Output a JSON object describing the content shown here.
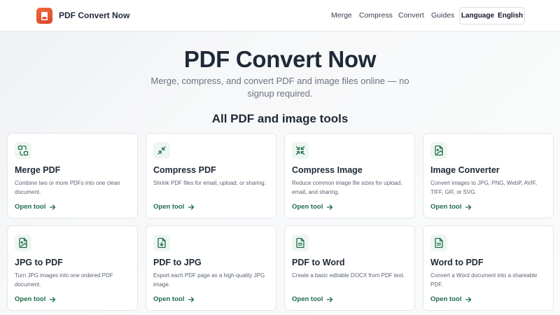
{
  "header": {
    "brand": "PDF Convert Now",
    "nav": [
      "Merge",
      "Compress",
      "Convert",
      "Guides"
    ],
    "language_label": "Language",
    "language_value": "English"
  },
  "hero": {
    "title": "PDF Convert Now",
    "subtitle": "Merge, compress, and convert PDF and image files online — no signup required."
  },
  "section": {
    "title": "All PDF and image tools"
  },
  "tools": [
    {
      "title": "Merge PDF",
      "desc": "Combine two or more PDFs into one clean document.",
      "link": "Open tool",
      "icon": "merge-icon"
    },
    {
      "title": "Compress PDF",
      "desc": "Shrink PDF files for email, upload, or sharing.",
      "link": "Open tool",
      "icon": "compress-icon"
    },
    {
      "title": "Compress Image",
      "desc": "Reduce common image file sizes for upload, email, and sharing.",
      "link": "Open tool",
      "icon": "compress-icon"
    },
    {
      "title": "Image Converter",
      "desc": "Convert images to JPG, PNG, WebP, AVIF, TIFF, GIF, or SVG.",
      "link": "Open tool",
      "icon": "image-file-icon"
    },
    {
      "title": "JPG to PDF",
      "desc": "Turn JPG images into one ordered PDF document.",
      "link": "Open tool",
      "icon": "image-file-icon"
    },
    {
      "title": "PDF to JPG",
      "desc": "Export each PDF page as a high-quality JPG image.",
      "link": "Open tool",
      "icon": "file-export-icon"
    },
    {
      "title": "PDF to Word",
      "desc": "Create a basic editable DOCX from PDF text.",
      "link": "Open tool",
      "icon": "document-icon"
    },
    {
      "title": "Word to PDF",
      "desc": "Convert a Word document into a shareable PDF.",
      "link": "Open tool",
      "icon": "document-icon"
    }
  ],
  "colors": {
    "accent": "#1e6b49",
    "brand": "#e4572e",
    "icon_bg": "#eef6f2"
  }
}
